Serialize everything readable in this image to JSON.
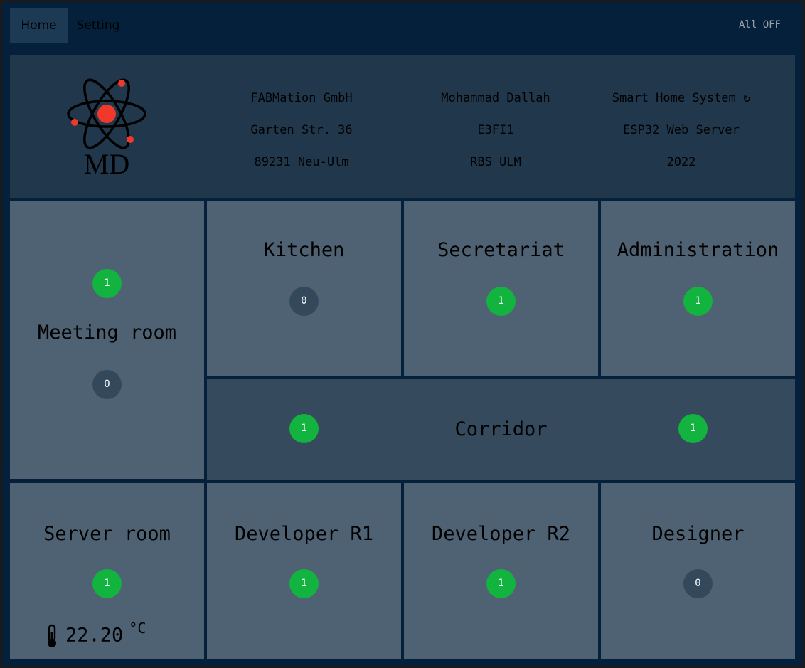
{
  "nav": {
    "tabs": [
      {
        "label": "Home",
        "active": true
      },
      {
        "label": "Setting",
        "active": false
      }
    ],
    "all_off_label": "All OFF"
  },
  "header": {
    "logo_text": "MD",
    "company": [
      "FABMation GmbH",
      "Garten Str. 36",
      "89231 Neu-Ulm"
    ],
    "author": [
      "Mohammad Dallah",
      "E3FI1",
      "RBS ULM"
    ],
    "project": [
      "Smart Home System ↻",
      "ESP32 Web Server",
      "2022"
    ]
  },
  "rooms": {
    "meeting": {
      "name": "Meeting room",
      "lights": [
        "1",
        "0"
      ]
    },
    "kitchen": {
      "name": "Kitchen",
      "lights": [
        "0"
      ]
    },
    "secretariat": {
      "name": "Secretariat",
      "lights": [
        "1"
      ]
    },
    "administration": {
      "name": "Administration",
      "lights": [
        "1"
      ]
    },
    "corridor": {
      "name": "Corridor",
      "lights": [
        "1",
        "1"
      ]
    },
    "server": {
      "name": "Server room",
      "lights": [
        "1"
      ],
      "temperature": "22.20",
      "unit": "°C"
    },
    "dev1": {
      "name": "Developer R1",
      "lights": [
        "1"
      ]
    },
    "dev2": {
      "name": "Developer R2",
      "lights": [
        "1"
      ]
    },
    "designer": {
      "name": "Designer",
      "lights": [
        "0"
      ]
    }
  },
  "colors": {
    "on": "#12b33e",
    "off": "#34485c",
    "logo_accent": "#f0382b"
  }
}
